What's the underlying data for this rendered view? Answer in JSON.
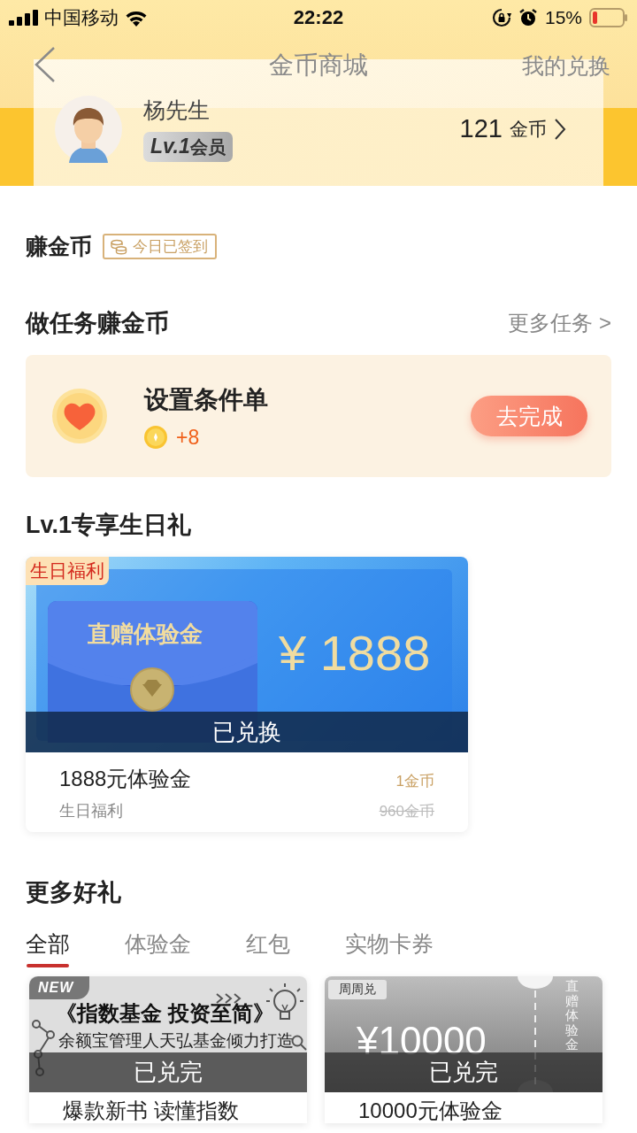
{
  "status_bar": {
    "carrier": "中国移动",
    "time": "22:22",
    "battery": "15%"
  },
  "nav": {
    "title": "金币商城",
    "action": "我的兑换"
  },
  "user": {
    "name": "杨先生",
    "level_badge": {
      "level": "Lv.1",
      "label": "会员"
    },
    "coins": "121",
    "coins_unit": "金币"
  },
  "earn": {
    "title": "赚金币",
    "checkin_badge": "今日已签到"
  },
  "tasks": {
    "title": "做任务赚金币",
    "more": "更多任务 >",
    "items": [
      {
        "name": "设置条件单",
        "reward": "+8",
        "button": "去完成"
      }
    ]
  },
  "birthday": {
    "title": "Lv.1专享生日礼",
    "card": {
      "tag": "生日福利",
      "banner_label": "直赠体验金",
      "banner_amount": "¥ 1888",
      "status": "已兑换",
      "name": "1888元体验金",
      "subtitle": "生日福利",
      "price": "1金币",
      "original_price": "960金币"
    }
  },
  "more_gifts": {
    "title": "更多好礼",
    "tabs": [
      {
        "label": "全部",
        "selected": true
      },
      {
        "label": "体验金",
        "selected": false
      },
      {
        "label": "红包",
        "selected": false
      },
      {
        "label": "实物卡券",
        "selected": false
      }
    ],
    "items": [
      {
        "kind": "book",
        "tag": "NEW",
        "headline": "《指数基金 投资至简》",
        "subline": "余额宝管理人天弘基金倾力打造",
        "status": "已兑完",
        "name": "爆款新书 读懂指数"
      },
      {
        "kind": "voucher",
        "tag": "周周兑",
        "amount": "¥10000",
        "side_label": "直赠体验金",
        "status": "已兑完",
        "name": "10000元体验金"
      }
    ]
  }
}
